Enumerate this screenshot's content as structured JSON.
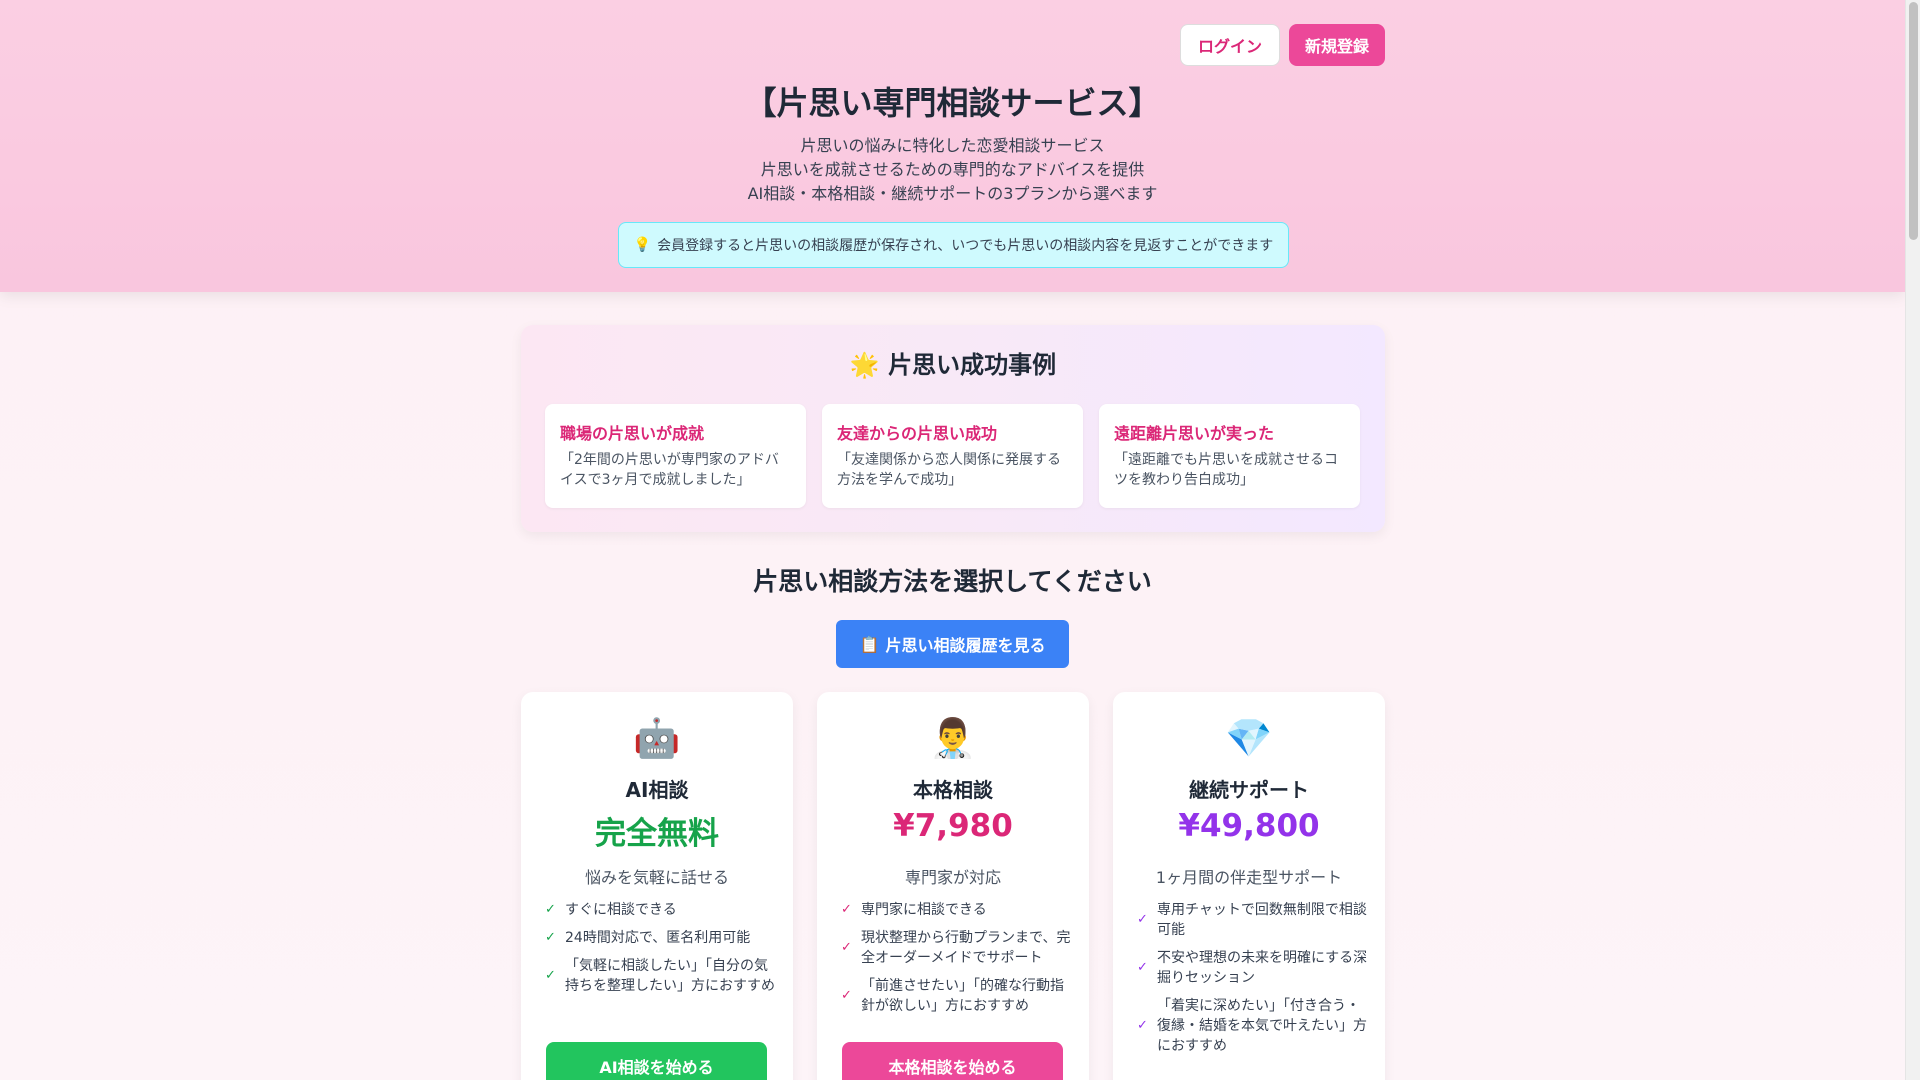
{
  "header": {
    "login_label": "ログイン",
    "signup_label": "新規登録",
    "title": "【片思い専門相談サービス】",
    "desc": [
      "片思いの悩みに特化した恋愛相談サービス",
      "片思いを成就させるための専門的なアドバイスを提供",
      "AI相談・本格相談・継続サポートの3プランから選べます"
    ],
    "note_icon": "💡",
    "note_text": "会員登録すると片思いの相談履歴が保存され、いつでも片思いの相談内容を見返すことができます"
  },
  "stories": {
    "icon": "🌟",
    "title": "片思い成功事例",
    "items": [
      {
        "title": "職場の片思いが成就",
        "quote": "「2年間の片思いが専門家のアドバイスで3ヶ月で成就しました」"
      },
      {
        "title": "友達からの片思い成功",
        "quote": "「友達関係から恋人関係に発展する方法を学んで成功」"
      },
      {
        "title": "遠距離片思いが実った",
        "quote": "「遠距離でも片思いを成就させるコツを教わり告白成功」"
      }
    ]
  },
  "method": {
    "title": "片思い相談方法を選択してください",
    "history_icon": "📋",
    "history_label": "片思い相談履歴を見る"
  },
  "plans": [
    {
      "emoji": "🤖",
      "name": "AI相談",
      "price": "完全無料",
      "price_color": "#16a34a",
      "sub": "悩みを気軽に話せる",
      "check_color": "#16a34a",
      "features": [
        "すぐに相談できる",
        "24時間対応で、匿名利用可能",
        "「気軽に相談したい」「自分の気持ちを整理したい」方におすすめ"
      ],
      "cta": "AI相談を始める",
      "cta_color": "#22c55e"
    },
    {
      "emoji": "👨‍⚕️",
      "name": "本格相談",
      "price": "¥7,980",
      "price_color": "#db2777",
      "sub": "専門家が対応",
      "check_color": "#db2777",
      "features": [
        "専門家に相談できる",
        "現状整理から行動プランまで、完全オーダーメイドでサポート",
        "「前進させたい」「的確な行動指針が欲しい」方におすすめ"
      ],
      "cta": "本格相談を始める",
      "cta_color": "#ec4899"
    },
    {
      "emoji": "💎",
      "name": "継続サポート",
      "price": "¥49,800",
      "price_color": "#9333ea",
      "sub": "1ヶ月間の伴走型サポート",
      "check_color": "#9333ea",
      "features": [
        "専用チャットで回数無制限で相談可能",
        "不安や理想の未来を明確にする深掘りセッション",
        "「着実に深めたい」「付き合う・復縁・結婚を本気で叶えたい」方におすすめ"
      ],
      "cta": "",
      "cta_color": ""
    }
  ]
}
